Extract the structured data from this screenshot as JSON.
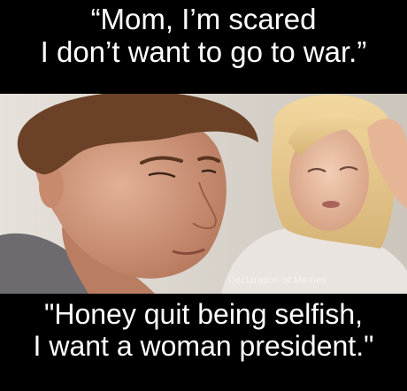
{
  "top_caption": {
    "line1": "“Mom, I’m scared",
    "line2": "I don’t want to go to war.”"
  },
  "bottom_caption": {
    "line1": "\"Honey quit being selfish,",
    "line2": "I want a woman president.\""
  },
  "watermark": "Declaration of Memes",
  "colors": {
    "background": "#000000",
    "caption_text": "#ffffff"
  }
}
